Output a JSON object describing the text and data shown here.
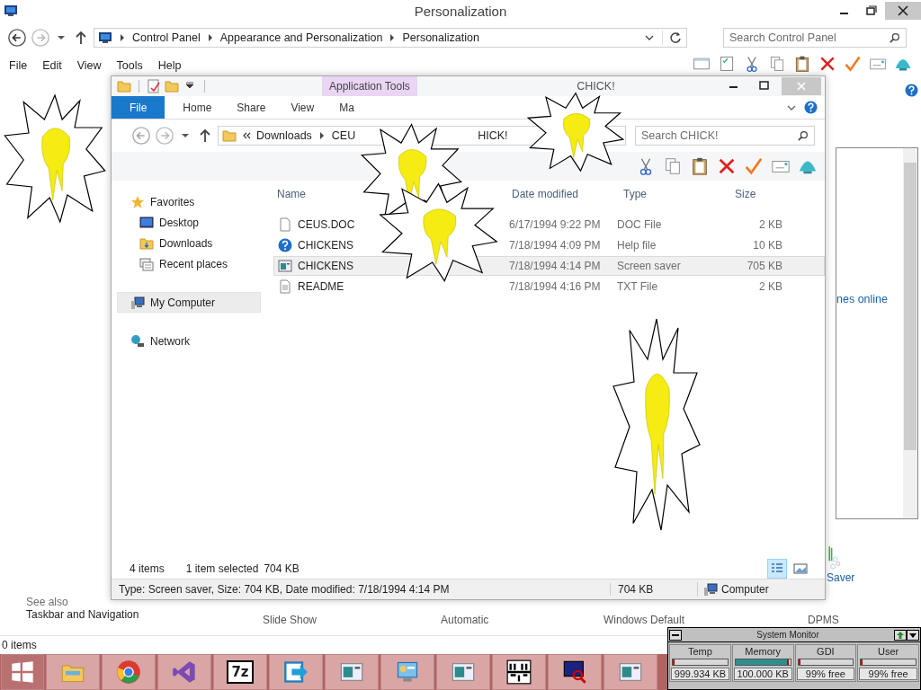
{
  "control_panel": {
    "title": "Personalization",
    "breadcrumb": [
      "Control Panel",
      "Appearance and Personalization",
      "Personalization"
    ],
    "search": {
      "placeholder": "Search Control Panel"
    },
    "menu": [
      "File",
      "Edit",
      "View",
      "Tools",
      "Help"
    ],
    "online_link": "nes online",
    "saver_label": "Saver",
    "see_also": {
      "heading": "See also",
      "links": [
        "Taskbar and Navigation"
      ]
    },
    "theme_row": [
      "Slide Show",
      "Automatic",
      "Windows Default",
      "DPMS"
    ],
    "status": "0 items"
  },
  "explorer": {
    "title": "CHICK!",
    "context_tab": "Application Tools",
    "tabs": [
      {
        "label": "File",
        "kind": "file"
      },
      {
        "label": "Home",
        "kind": "tab"
      },
      {
        "label": "Share",
        "kind": "tab"
      },
      {
        "label": "View",
        "kind": "tab"
      },
      {
        "label": "Ma",
        "kind": "tab"
      }
    ],
    "path": [
      "Downloads",
      "CEU",
      "HICK!"
    ],
    "search": {
      "placeholder": "Search CHICK!"
    },
    "nav": [
      {
        "label": "Favorites",
        "kind": "star",
        "selected": false,
        "children": [
          {
            "label": "Desktop",
            "kind": "desktop",
            "selected": false
          },
          {
            "label": "Downloads",
            "kind": "folder",
            "selected": false
          },
          {
            "label": "Recent places",
            "kind": "recent",
            "selected": false
          }
        ]
      },
      {
        "label": "My Computer",
        "kind": "computer",
        "selected": true
      },
      {
        "label": "Network",
        "kind": "network",
        "selected": false
      }
    ],
    "columns": [
      "Name",
      "Date modified",
      "Type",
      "Size"
    ],
    "files": [
      {
        "name": "CEUS.DOC",
        "date": "6/17/1994 9:22 PM",
        "type": "DOC File",
        "size": "2 KB",
        "kind": "doc",
        "selected": false
      },
      {
        "name": "CHICKENS",
        "date": "7/18/1994 4:09 PM",
        "type": "Help file",
        "size": "10 KB",
        "kind": "help",
        "selected": false
      },
      {
        "name": "CHICKENS",
        "date": "7/18/1994 4:14 PM",
        "type": "Screen saver",
        "size": "705 KB",
        "kind": "saver",
        "selected": true
      },
      {
        "name": "README",
        "date": "7/18/1994 4:16 PM",
        "type": "TXT File",
        "size": "2 KB",
        "kind": "txt",
        "selected": false
      }
    ],
    "item_count": "4 items",
    "selection": "1 item selected",
    "selection_size": "704 KB",
    "details": "Type: Screen saver, Size: 704 KB, Date modified: 7/18/1994 4:14 PM",
    "details_size": "704 KB",
    "zone": "Computer"
  },
  "system_monitor": {
    "title": "System Monitor",
    "meters": [
      {
        "name": "Temp",
        "level": 0,
        "reading": "999.934 KB"
      },
      {
        "name": "Memory",
        "level": 0.95,
        "reading": "100.000 KB"
      },
      {
        "name": "GDI",
        "level": 0,
        "reading": "99% free"
      },
      {
        "name": "User",
        "level": 0,
        "reading": "99% free"
      }
    ]
  },
  "taskbar": [
    {
      "kind": "start"
    },
    {
      "kind": "folder"
    },
    {
      "kind": "browser"
    },
    {
      "kind": "studio"
    },
    {
      "kind": "archiver",
      "label": "7z"
    },
    {
      "kind": "transfer"
    },
    {
      "kind": "window"
    },
    {
      "kind": "panel"
    },
    {
      "kind": "window"
    },
    {
      "kind": "charmap"
    },
    {
      "kind": "monitor"
    },
    {
      "kind": "window"
    }
  ]
}
